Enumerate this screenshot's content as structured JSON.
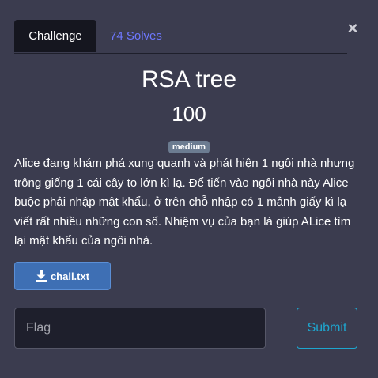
{
  "tabs": {
    "challenge": "Challenge",
    "solves": "74 Solves"
  },
  "close_glyph": "×",
  "challenge": {
    "name": "RSA tree",
    "points": "100",
    "difficulty": "medium",
    "description": "Alice đang khám phá xung quanh và phát hiện 1 ngôi nhà nhưng trông giống 1 cái cây to lớn kì lạ. Để tiến vào ngôi nhà này Alice buộc phải nhập mật khẩu, ở trên chỗ nhập có 1 mảnh giấy kì lạ viết rất nhiều những con số. Nhiệm vụ của bạn là giúp ALice tìm lại mật khẩu của ngôi nhà.",
    "file": "chall.txt"
  },
  "form": {
    "flag_placeholder": "Flag",
    "flag_value": "",
    "submit_label": "Submit"
  },
  "colors": {
    "background": "#3b3c4f",
    "active_tab": "#15161f",
    "link": "#6e78ff",
    "badge": "#6c7c91",
    "file_button": "#3e6fb4",
    "submit": "#1ea6cf",
    "input_bg": "#1e1f2c"
  },
  "icons": {
    "close": "close-icon",
    "download": "download-icon"
  }
}
